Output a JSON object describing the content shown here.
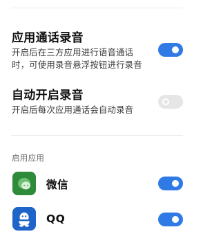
{
  "settings": [
    {
      "title": "应用通话录音",
      "description_lines": [
        "开启后在三方应用进行语音通话",
        "时，可使用录音悬浮按钮进行录音"
      ],
      "enabled": true
    },
    {
      "title": "自动开启录音",
      "description_lines": [
        "开启后每次应用通话会自动录音"
      ],
      "enabled": false
    }
  ],
  "apps_section": {
    "label": "启用应用",
    "apps": [
      {
        "name": "微信",
        "icon": "wechat-icon",
        "icon_color": "#2e8b3a",
        "enabled": true
      },
      {
        "name": "QQ",
        "icon": "qq-icon",
        "icon_color": "#1f64c8",
        "enabled": true
      }
    ]
  },
  "colors": {
    "accent": "#2f7ae5",
    "toggle_off": "#e6e6e6"
  }
}
